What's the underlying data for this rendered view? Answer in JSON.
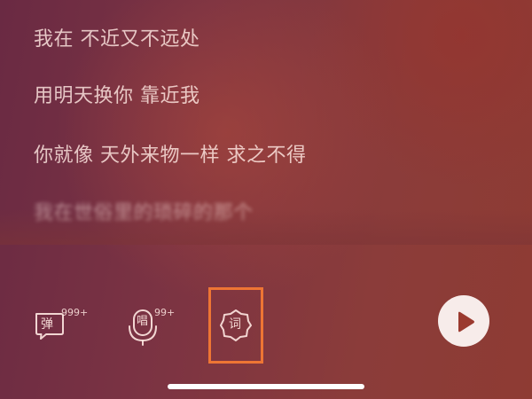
{
  "lyrics": {
    "lines": [
      "我在 不近又不远处",
      "用明天换你 靠近我",
      "你就像 天外来物一样 求之不得",
      "我在世俗里的琐碎的那个"
    ]
  },
  "toolbar": {
    "danmaku": {
      "glyph": "弹",
      "count": "999+",
      "icon": "danmaku-icon"
    },
    "sing": {
      "glyph": "唱",
      "count": "99+",
      "icon": "microphone-icon"
    },
    "lyrics": {
      "glyph": "词",
      "icon": "lyrics-badge-icon"
    },
    "play": {
      "icon": "play-icon"
    }
  },
  "colors": {
    "highlight": "#ee7534",
    "play_button_bg": "#f7ecea",
    "play_glyph": "#9b3a2f",
    "text": "#ffe8e2"
  }
}
